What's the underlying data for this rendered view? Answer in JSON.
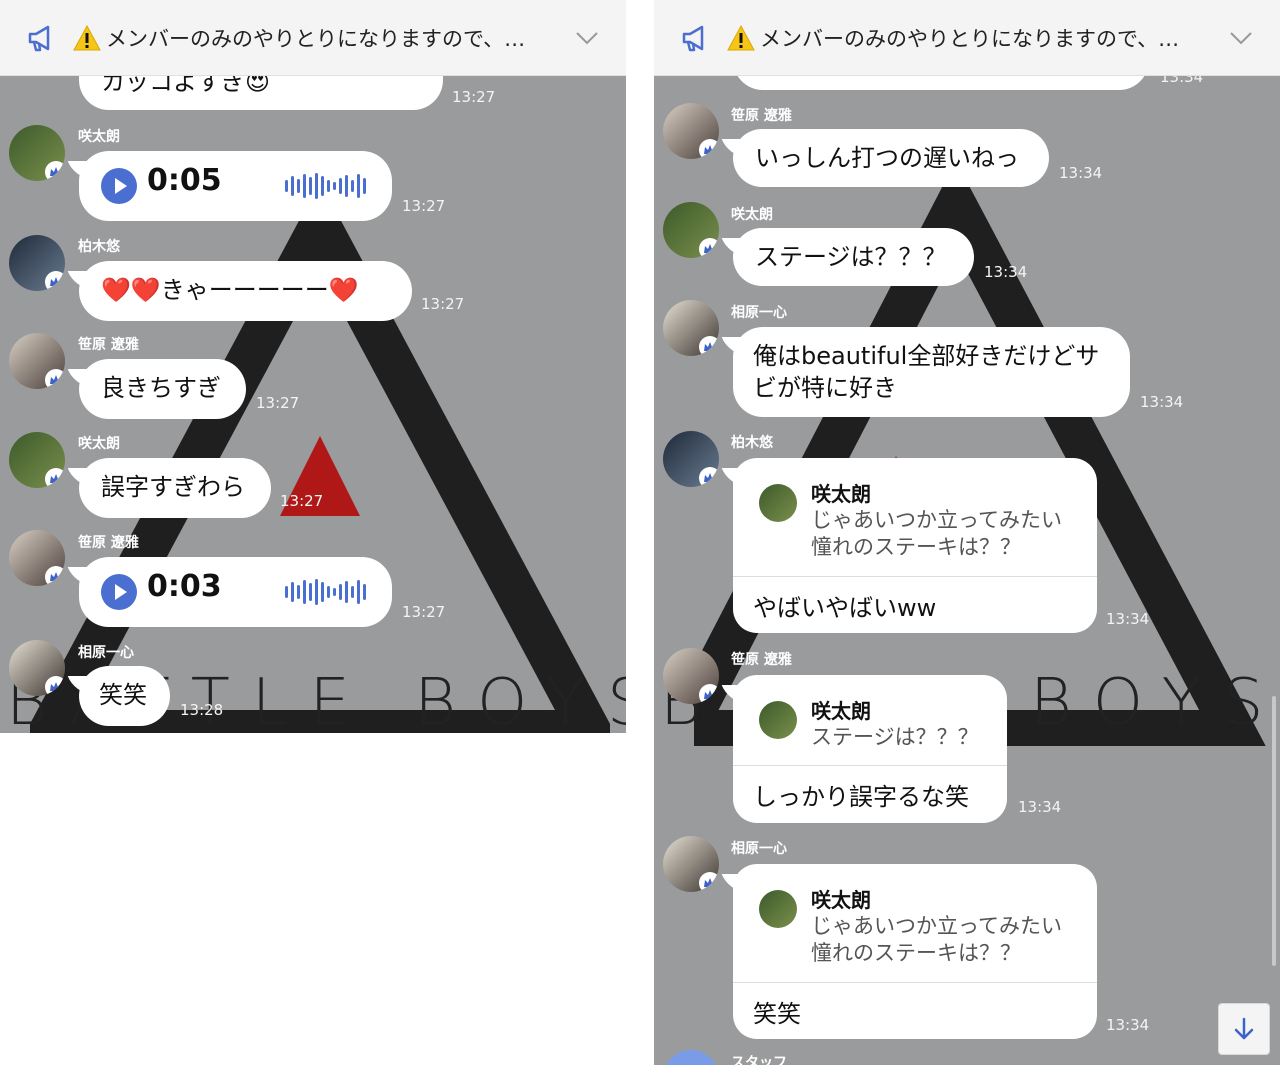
{
  "notice": {
    "text": "メンバーのみのやりとりになりますので、…"
  },
  "left": {
    "partial_emoji": "😍",
    "partial_text": "カッコよすぎ",
    "partial_time": "13:27",
    "messages": [
      {
        "sender": "咲太朗",
        "type": "voice",
        "duration": "0:05",
        "time": "13:27"
      },
      {
        "sender": "柏木悠",
        "type": "text",
        "text": "❤️❤️きゃーーーーー❤️",
        "time": "13:27"
      },
      {
        "sender": "笹原 遼雅",
        "type": "text",
        "text": "良きちすぎ",
        "time": "13:27"
      },
      {
        "sender": "咲太朗",
        "type": "text",
        "text": "誤字すぎわら",
        "time": "13:27"
      },
      {
        "sender": "笹原 遼雅",
        "type": "voice",
        "duration": "0:03",
        "time": "13:27"
      },
      {
        "sender": "相原一心",
        "type": "text",
        "text": "笑笑",
        "time": "13:28"
      }
    ]
  },
  "right": {
    "partial_time": "13:34",
    "messages": [
      {
        "sender": "笹原 遼雅",
        "type": "text",
        "text": "いっしん打つの遅いねっ",
        "time": "13:34"
      },
      {
        "sender": "咲太朗",
        "type": "text",
        "text": "ステージは？？？",
        "time": "13:34"
      },
      {
        "sender": "相原一心",
        "type": "text",
        "lines": [
          "俺はbeautiful全部好きだけどサ",
          "ビが特に好き"
        ],
        "time": "13:34"
      },
      {
        "sender": "柏木悠",
        "type": "reply",
        "quote_name": "咲太朗",
        "quote_lines": [
          "じゃあいつか立ってみたい",
          "憧れのステーキは？？"
        ],
        "text": "やばいやばいww",
        "time": "13:34"
      },
      {
        "sender": "笹原 遼雅",
        "type": "reply",
        "quote_name": "咲太朗",
        "quote_lines": [
          "ステージは？？？"
        ],
        "text": "しっかり誤字るな笑",
        "time": "13:34"
      },
      {
        "sender": "相原一心",
        "type": "reply",
        "quote_name": "咲太朗",
        "quote_lines": [
          "じゃあいつか立ってみたい",
          "憧れのステーキは？？"
        ],
        "text": "笑笑",
        "time": "13:34"
      }
    ],
    "next_sender_partial": "スタッフ"
  },
  "background_logo": {
    "text": "BATTLE BOYS",
    "text_right": "BOYS"
  },
  "colors": {
    "chat_bg": "#9a9b9d",
    "accent_blue": "#4a6fd0",
    "badge_blue": "#3d63c9",
    "header_bg": "#f4f4f4"
  },
  "icons": {
    "notice": "megaphone-icon",
    "warning": "warning-icon",
    "expand": "chevron-down-icon",
    "crown": "crown-icon",
    "play": "play-icon",
    "scroll": "arrow-down-icon"
  }
}
